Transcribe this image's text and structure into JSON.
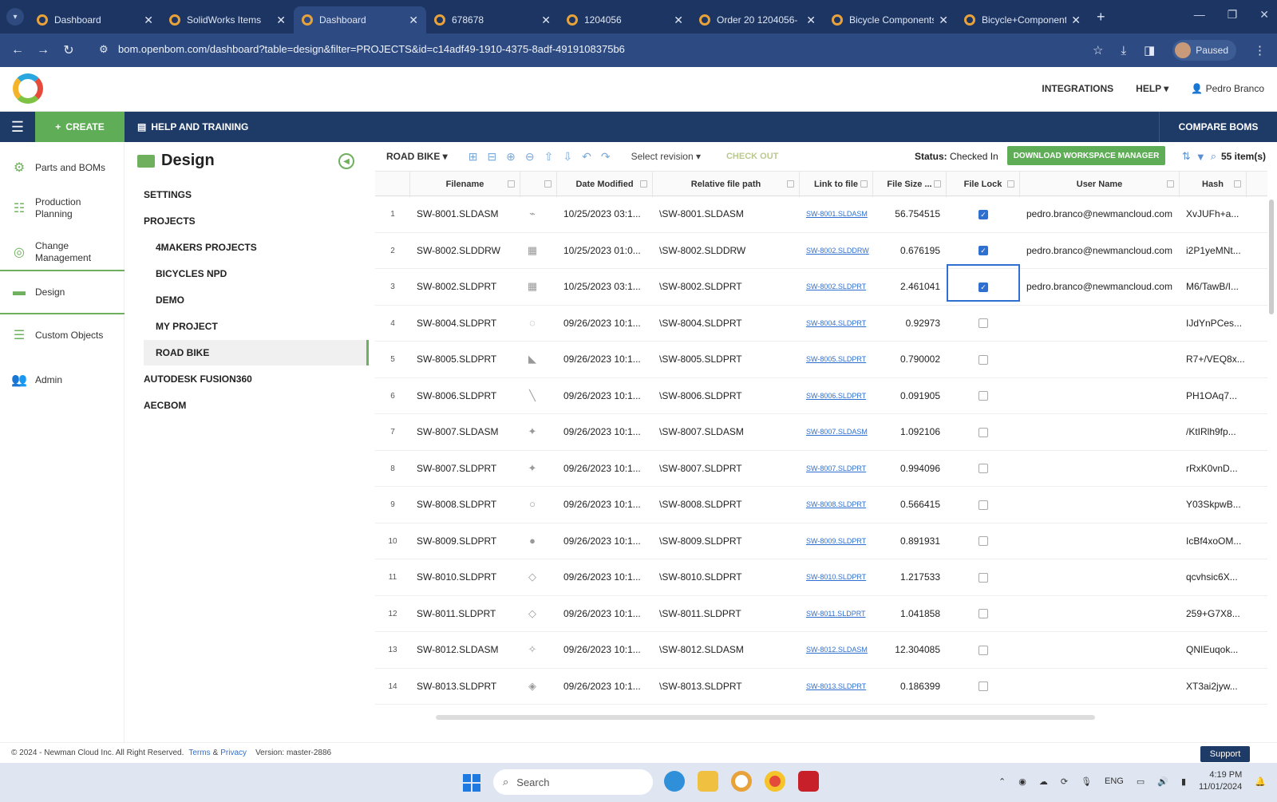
{
  "browser": {
    "tabs": [
      {
        "title": "Dashboard",
        "active": false
      },
      {
        "title": "SolidWorks Items",
        "active": false
      },
      {
        "title": "Dashboard",
        "active": true
      },
      {
        "title": "678678",
        "active": false
      },
      {
        "title": "1204056",
        "active": false
      },
      {
        "title": "Order 20 1204056-",
        "active": false
      },
      {
        "title": "Bicycle Components",
        "active": false
      },
      {
        "title": "Bicycle+Component",
        "active": false
      }
    ],
    "url": "bom.openbom.com/dashboard?table=design&filter=PROJECTS&id=c14adf49-1910-4375-8adf-4919108375b6",
    "profile_label": "Paused"
  },
  "header": {
    "integrations": "INTEGRATIONS",
    "help": "HELP ▾",
    "user": "Pedro Branco"
  },
  "appbar": {
    "create": "CREATE",
    "help_training": "HELP AND TRAINING",
    "compare": "COMPARE BOMS"
  },
  "sidebar": {
    "items": [
      {
        "label": "Parts and BOMs",
        "icon": "gear-icon"
      },
      {
        "label": "Production Planning",
        "icon": "planning-icon"
      },
      {
        "label": "Change Management",
        "icon": "change-icon"
      },
      {
        "label": "Design",
        "icon": "folder-icon"
      },
      {
        "label": "Custom Objects",
        "icon": "list-icon"
      },
      {
        "label": "Admin",
        "icon": "admin-icon"
      }
    ]
  },
  "projects": {
    "title": "Design",
    "settings": "SETTINGS",
    "projects_label": "PROJECTS",
    "list": [
      "4MAKERS PROJECTS",
      "BICYCLES NPD",
      "DEMO",
      "MY PROJECT",
      "ROAD BIKE"
    ],
    "autodesk": "AUTODESK FUSION360",
    "aecbom": "AECBOM"
  },
  "gridtoolbar": {
    "project": "ROAD BIKE ▾",
    "revision": "Select revision ▾",
    "checkout": "CHECK OUT",
    "status_label": "Status:",
    "status_value": "Checked In",
    "download": "DOWNLOAD WORKSPACE MANAGER",
    "count": "55 item(s)"
  },
  "table": {
    "columns": [
      "Filename",
      "Date Modified",
      "Relative file path",
      "Link to file",
      "File Size ...",
      "File Lock",
      "User Name",
      "Hash"
    ],
    "rows": [
      {
        "n": "1",
        "file": "SW-8001.SLDASM",
        "date": "10/25/2023 03:1...",
        "path": "\\SW-8001.SLDASM",
        "link": "SW-8001.SLDASM",
        "size": "56.754515",
        "lock": true,
        "user": "pedro.branco@newmancloud.com",
        "hash": "XvJUFh+a..."
      },
      {
        "n": "2",
        "file": "SW-8002.SLDDRW",
        "date": "10/25/2023 01:0...",
        "path": "\\SW-8002.SLDDRW",
        "link": "SW-8002.SLDDRW",
        "size": "0.676195",
        "lock": true,
        "user": "pedro.branco@newmancloud.com",
        "hash": "i2P1yeMNt..."
      },
      {
        "n": "3",
        "file": "SW-8002.SLDPRT",
        "date": "10/25/2023 03:1...",
        "path": "\\SW-8002.SLDPRT",
        "link": "SW-8002.SLDPRT",
        "size": "2.461041",
        "lock": true,
        "user": "pedro.branco@newmancloud.com",
        "hash": "M6/TawB/I..."
      },
      {
        "n": "4",
        "file": "SW-8004.SLDPRT",
        "date": "09/26/2023 10:1...",
        "path": "\\SW-8004.SLDPRT",
        "link": "SW-8004.SLDPRT",
        "size": "0.92973",
        "lock": false,
        "user": "",
        "hash": "IJdYnPCes..."
      },
      {
        "n": "5",
        "file": "SW-8005.SLDPRT",
        "date": "09/26/2023 10:1...",
        "path": "\\SW-8005.SLDPRT",
        "link": "SW-8005.SLDPRT",
        "size": "0.790002",
        "lock": false,
        "user": "",
        "hash": "R7+/VEQ8x..."
      },
      {
        "n": "6",
        "file": "SW-8006.SLDPRT",
        "date": "09/26/2023 10:1...",
        "path": "\\SW-8006.SLDPRT",
        "link": "SW-8006.SLDPRT",
        "size": "0.091905",
        "lock": false,
        "user": "",
        "hash": "PH1OAq7..."
      },
      {
        "n": "7",
        "file": "SW-8007.SLDASM",
        "date": "09/26/2023 10:1...",
        "path": "\\SW-8007.SLDASM",
        "link": "SW-8007.SLDASM",
        "size": "1.092106",
        "lock": false,
        "user": "",
        "hash": "/KtIRlh9fp..."
      },
      {
        "n": "8",
        "file": "SW-8007.SLDPRT",
        "date": "09/26/2023 10:1...",
        "path": "\\SW-8007.SLDPRT",
        "link": "SW-8007.SLDPRT",
        "size": "0.994096",
        "lock": false,
        "user": "",
        "hash": "rRxK0vnD..."
      },
      {
        "n": "9",
        "file": "SW-8008.SLDPRT",
        "date": "09/26/2023 10:1...",
        "path": "\\SW-8008.SLDPRT",
        "link": "SW-8008.SLDPRT",
        "size": "0.566415",
        "lock": false,
        "user": "",
        "hash": "Y03SkpwB..."
      },
      {
        "n": "10",
        "file": "SW-8009.SLDPRT",
        "date": "09/26/2023 10:1...",
        "path": "\\SW-8009.SLDPRT",
        "link": "SW-8009.SLDPRT",
        "size": "0.891931",
        "lock": false,
        "user": "",
        "hash": "IcBf4xoOM..."
      },
      {
        "n": "11",
        "file": "SW-8010.SLDPRT",
        "date": "09/26/2023 10:1...",
        "path": "\\SW-8010.SLDPRT",
        "link": "SW-8010.SLDPRT",
        "size": "1.217533",
        "lock": false,
        "user": "",
        "hash": "qcvhsic6X..."
      },
      {
        "n": "12",
        "file": "SW-8011.SLDPRT",
        "date": "09/26/2023 10:1...",
        "path": "\\SW-8011.SLDPRT",
        "link": "SW-8011.SLDPRT",
        "size": "1.041858",
        "lock": false,
        "user": "",
        "hash": "259+G7X8..."
      },
      {
        "n": "13",
        "file": "SW-8012.SLDASM",
        "date": "09/26/2023 10:1...",
        "path": "\\SW-8012.SLDASM",
        "link": "SW-8012.SLDASM",
        "size": "12.304085",
        "lock": false,
        "user": "",
        "hash": "QNIEuqok..."
      },
      {
        "n": "14",
        "file": "SW-8013.SLDPRT",
        "date": "09/26/2023 10:1...",
        "path": "\\SW-8013.SLDPRT",
        "link": "SW-8013.SLDPRT",
        "size": "0.186399",
        "lock": false,
        "user": "",
        "hash": "XT3ai2jyw..."
      }
    ]
  },
  "footer": {
    "copyright": "© 2024 - Newman Cloud Inc. All Right Reserved.",
    "terms": "Terms",
    "amp": "&",
    "privacy": "Privacy",
    "version": "Version: master-2886",
    "support": "Support"
  },
  "taskbar": {
    "search": "Search",
    "lang": "ENG",
    "time": "4:19 PM",
    "date": "11/01/2024"
  },
  "colors": {
    "navy": "#1e3a66",
    "green": "#5fae57",
    "link": "#2f6fcf"
  }
}
